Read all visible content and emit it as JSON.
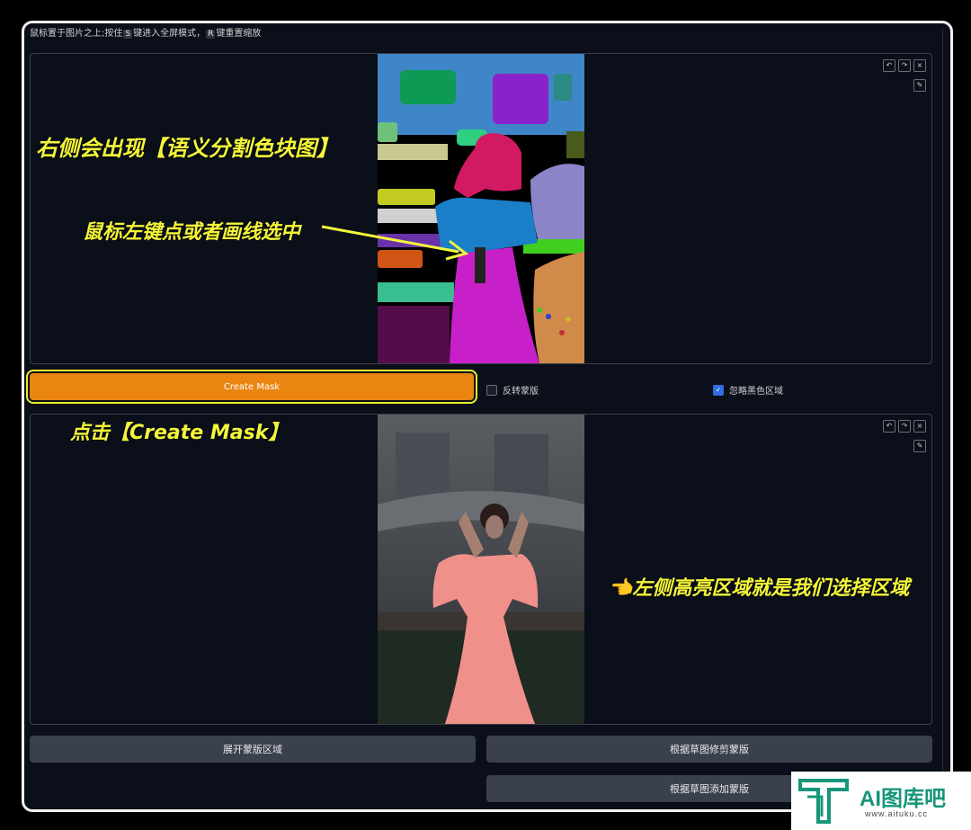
{
  "hint": {
    "text_before": "鼠标置于图片之上;按住",
    "key1": "S",
    "text_middle": "键进入全屏模式，",
    "key2": "R",
    "text_after": "键重置缩放"
  },
  "toolbar_icons": [
    "undo-icon",
    "redo-icon",
    "close-icon",
    "brush-icon"
  ],
  "buttons": {
    "create_mask": "Create Mask",
    "expand_mask": "展开蒙版区域",
    "trim_mask": "根据草图修剪蒙版",
    "add_mask": "根据草图添加蒙版"
  },
  "checkboxes": {
    "invert_label": "反转蒙版",
    "invert_checked": false,
    "ignore_black_label": "忽略黑色区域",
    "ignore_black_checked": true
  },
  "annotations": {
    "seg_appears": "右侧会出现【语义分割色块图】",
    "click_select": "鼠标左键点或者画线选中",
    "click_create": "点击【Create Mask】",
    "highlight": "👈左侧高亮区域就是我们选择区域"
  },
  "watermark": {
    "name": "AI图库吧",
    "url": "www.aituku.cc"
  },
  "colors": {
    "accent": "#ea8512",
    "annotation": "#f3f53a",
    "highlight_border": "#e6f02a"
  }
}
